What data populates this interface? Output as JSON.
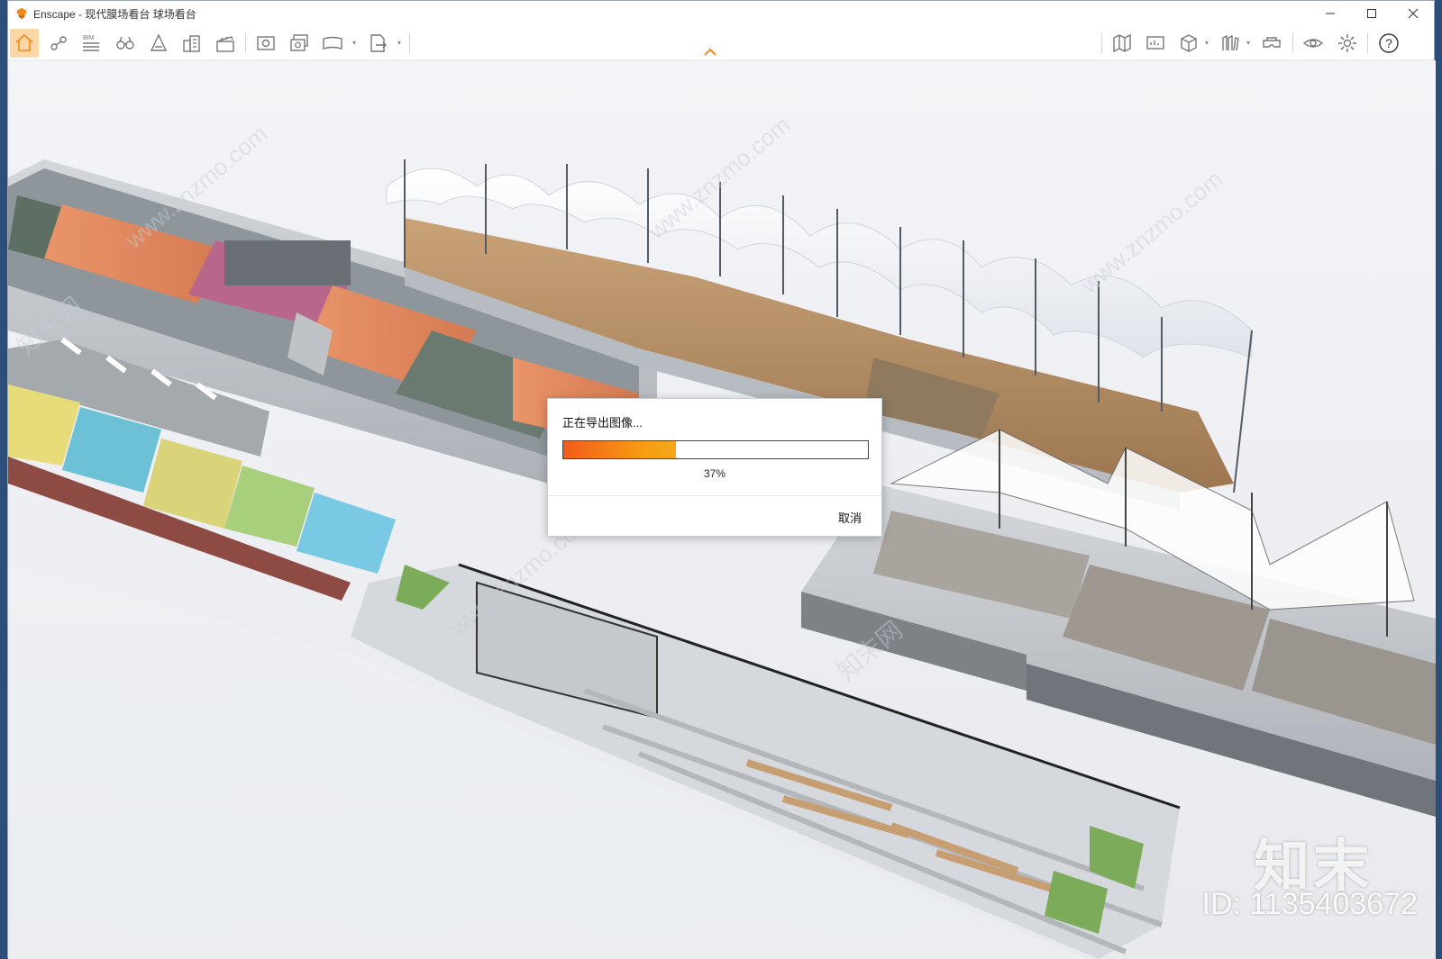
{
  "window": {
    "app_name": "Enscape",
    "title": "Enscape - 现代膜场看台 球场看台"
  },
  "toolbar": {
    "left_icons": [
      "home-icon",
      "connect-icon",
      "bim-icon",
      "binoculars-icon",
      "atmosphere-icon",
      "buildings-icon",
      "clapper-icon",
      "screenshot-icon",
      "batch-render-icon",
      "panorama-icon",
      "export-icon"
    ],
    "right_icons": [
      "map-icon",
      "presentation-icon",
      "cube-icon",
      "asset-library-icon",
      "vr-headset-icon",
      "visual-settings-icon",
      "gear-icon",
      "help-icon"
    ],
    "active": "home-icon",
    "help_label": "?",
    "bim_label": "BIM"
  },
  "watermark": {
    "brand": "知末",
    "id_label": "ID: 1135403672",
    "repeat": [
      "www.znzmo.com",
      "知末网"
    ]
  },
  "dialog": {
    "title": "正在导出图像...",
    "progress": 0.37,
    "progress_label": "37%",
    "cancel_label": "取消"
  },
  "colors": {
    "accent": "#f28a1e",
    "progress_start": "#f25c1c",
    "progress_end": "#f7a91a"
  }
}
